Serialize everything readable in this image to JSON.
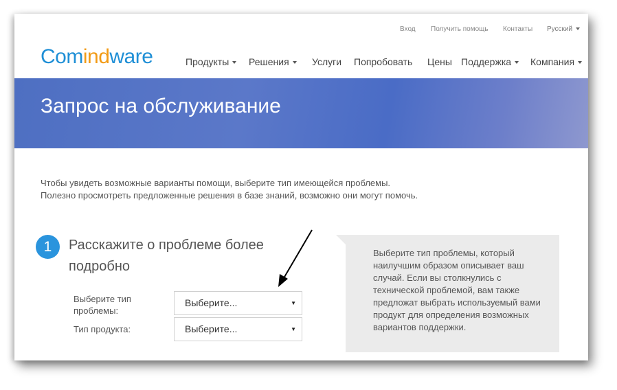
{
  "top_links": {
    "login": "Вход",
    "get_help": "Получить помощь",
    "contacts": "Контакты",
    "language": "Русский"
  },
  "logo": {
    "part1": "Com",
    "part2": "ind",
    "part3": "ware"
  },
  "nav": {
    "products": "Продукты",
    "solutions": "Решения",
    "services": "Услуги",
    "try": "Попробовать",
    "prices": "Цены",
    "support": "Поддержка",
    "company": "Компания"
  },
  "hero": {
    "title": "Запрос на обслуживание"
  },
  "intro": {
    "line1": "Чтобы увидеть возможные варианты помощи, выберите тип имеющейся проблемы.",
    "line2": "Полезно просмотреть предложенные решения в базе знаний, возможно они могут помочь."
  },
  "step": {
    "number": "1",
    "title": "Расскажите о проблеме более подробно"
  },
  "form": {
    "problem_type_label": "Выберите тип проблемы:",
    "problem_type_value": "Выберите...",
    "product_type_label": "Тип продукта:",
    "product_type_value": "Выберите..."
  },
  "info_box": {
    "text": "Выберите тип проблемы, который наилучшим образом описывает ваш случай. Если вы столкнулись с технической проблемой, вам также предложат выбрать используемый вами продукт для определения возможных вариантов поддержки."
  },
  "colors": {
    "brand_blue": "#1f8fd6",
    "brand_orange": "#f29b16",
    "hero": "#4e6fc2",
    "step_badge": "#2a94dd"
  }
}
